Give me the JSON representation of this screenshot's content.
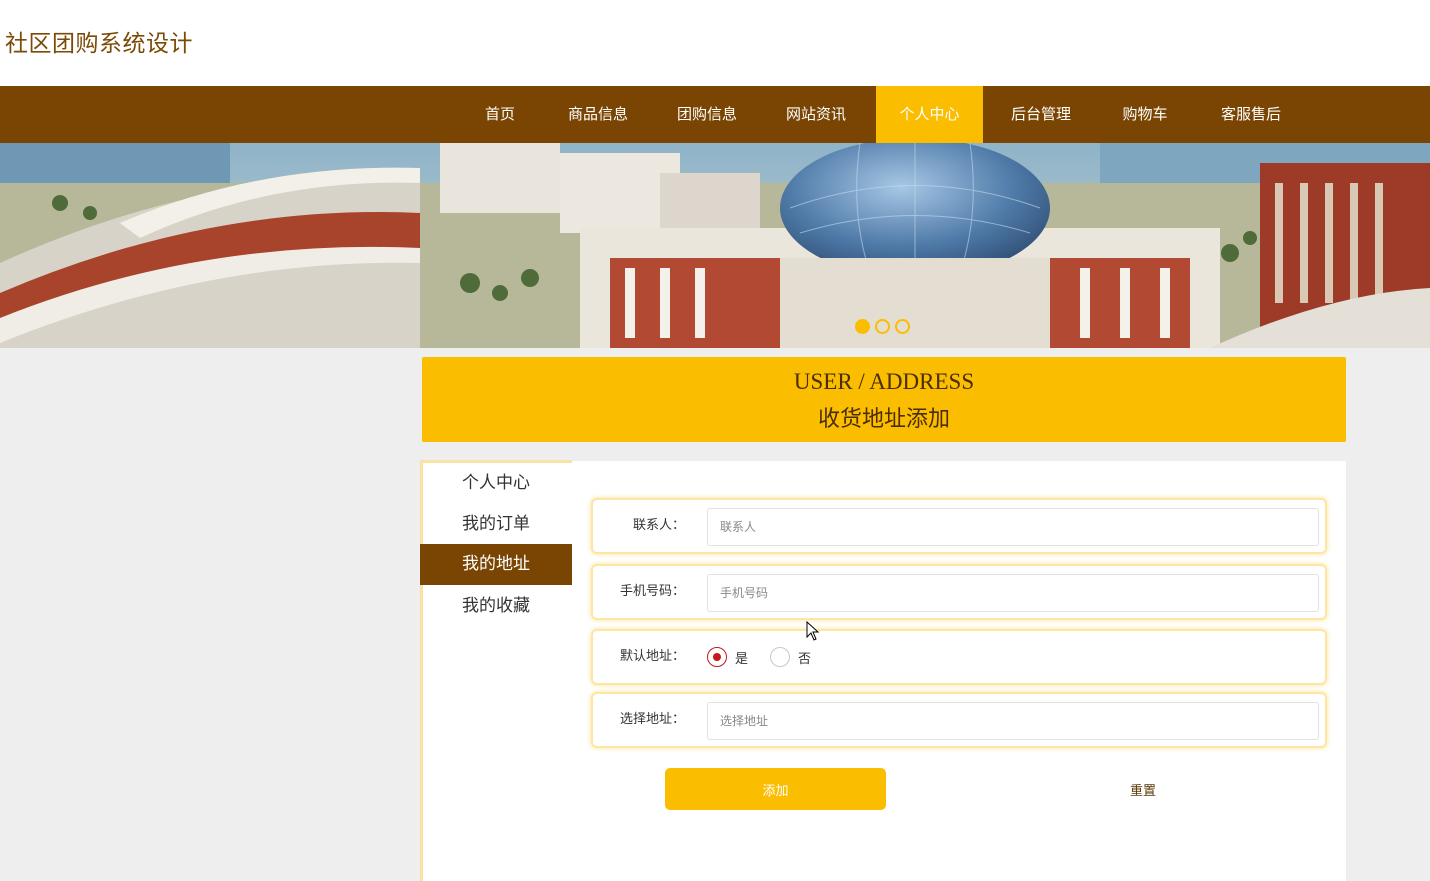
{
  "site": {
    "title": "社区团购系统设计"
  },
  "nav": {
    "items": [
      {
        "label": "首页"
      },
      {
        "label": "商品信息"
      },
      {
        "label": "团购信息"
      },
      {
        "label": "网站资讯"
      },
      {
        "label": "个人中心"
      },
      {
        "label": "后台管理"
      },
      {
        "label": "购物车"
      },
      {
        "label": "客服售后"
      }
    ],
    "active": "个人中心"
  },
  "banner": {
    "slide_count": 3,
    "active_slide": 1
  },
  "section": {
    "title_en": "USER / ADDRESS",
    "title_cn": "收货地址添加"
  },
  "sidebar": {
    "items": [
      {
        "label": "个人中心"
      },
      {
        "label": "我的订单"
      },
      {
        "label": "我的地址"
      },
      {
        "label": "我的收藏"
      }
    ],
    "active": "我的地址"
  },
  "form": {
    "contact": {
      "label": "联系人：",
      "value": "",
      "placeholder": "联系人"
    },
    "phone": {
      "label": "手机号码：",
      "value": "",
      "placeholder": "手机号码"
    },
    "default": {
      "label": "默认地址：",
      "options": [
        "是",
        "否"
      ],
      "selected": "是"
    },
    "address": {
      "label": "选择地址：",
      "value": "",
      "placeholder": "选择地址"
    },
    "add_label": "添加",
    "reset_label": "重置"
  },
  "colors": {
    "brand_brown": "#7a4503",
    "accent_yellow": "#fbbd00",
    "radio_red": "#c8161d"
  }
}
